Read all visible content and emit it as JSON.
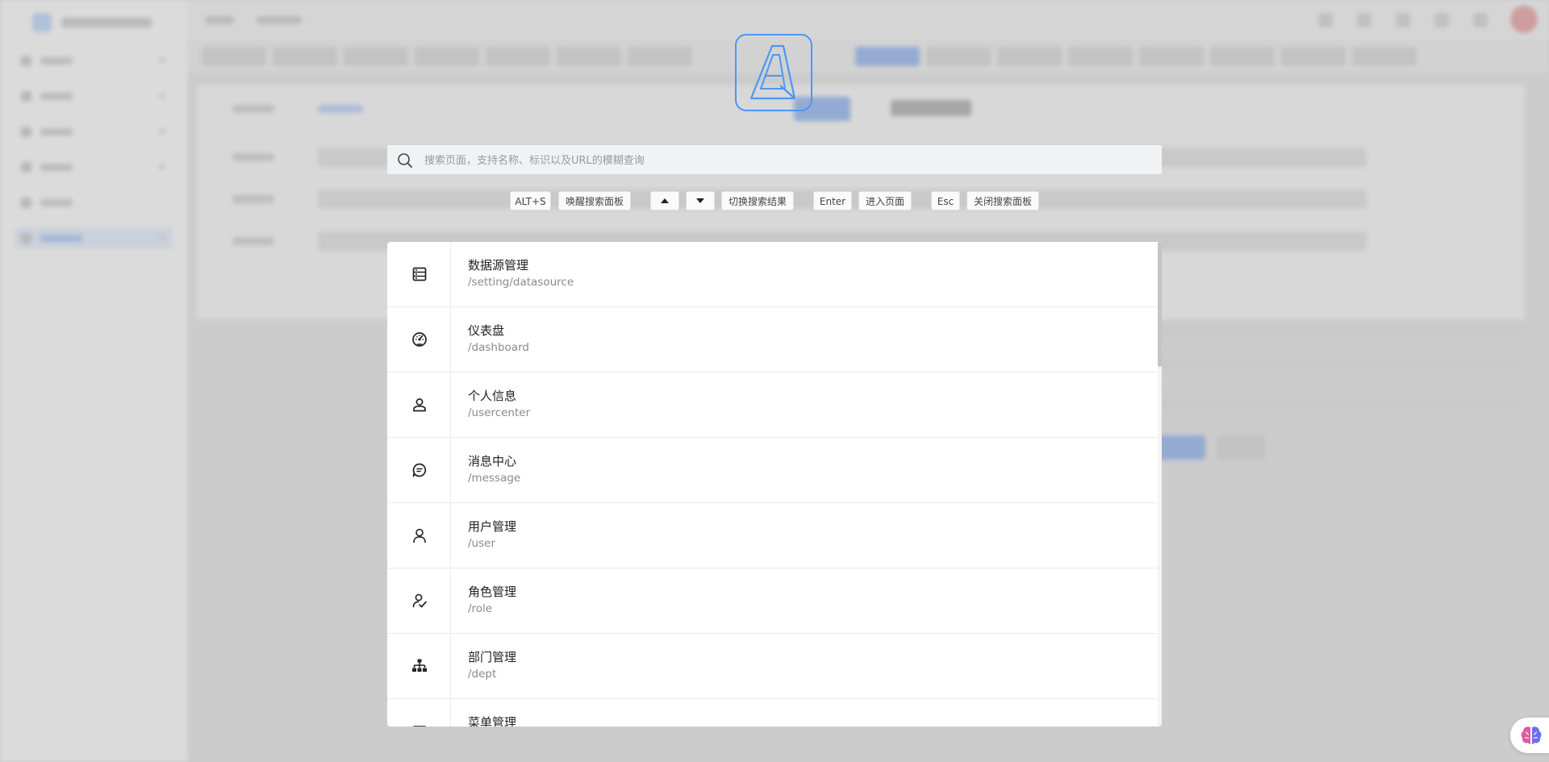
{
  "search": {
    "placeholder": "搜索页面，支持名称、标识以及URL的模糊查询"
  },
  "hints": [
    {
      "key": "ALT+S",
      "action": "唤醒搜索面板"
    },
    {
      "key": "arrow-up-icon",
      "key2": "arrow-down-icon",
      "action": "切换搜索结果"
    },
    {
      "key": "Enter",
      "action": "进入页面"
    },
    {
      "key": "Esc",
      "action": "关闭搜索面板"
    }
  ],
  "results": [
    {
      "name": "数据源管理",
      "path": "/setting/datasource",
      "icon": "database-icon"
    },
    {
      "name": "仪表盘",
      "path": "/dashboard",
      "icon": "dashboard-icon"
    },
    {
      "name": "个人信息",
      "path": "/usercenter",
      "icon": "user-profile-icon"
    },
    {
      "name": "消息中心",
      "path": "/message",
      "icon": "message-icon"
    },
    {
      "name": "用户管理",
      "path": "/user",
      "icon": "user-icon"
    },
    {
      "name": "角色管理",
      "path": "/role",
      "icon": "role-icon"
    },
    {
      "name": "部门管理",
      "path": "/dept",
      "icon": "org-chart-icon"
    },
    {
      "name": "菜单管理",
      "path": "",
      "icon": "menu-icon"
    }
  ],
  "colors": {
    "brand": "#4c97f4",
    "overlay": "rgba(0,0,0,0.11)"
  }
}
